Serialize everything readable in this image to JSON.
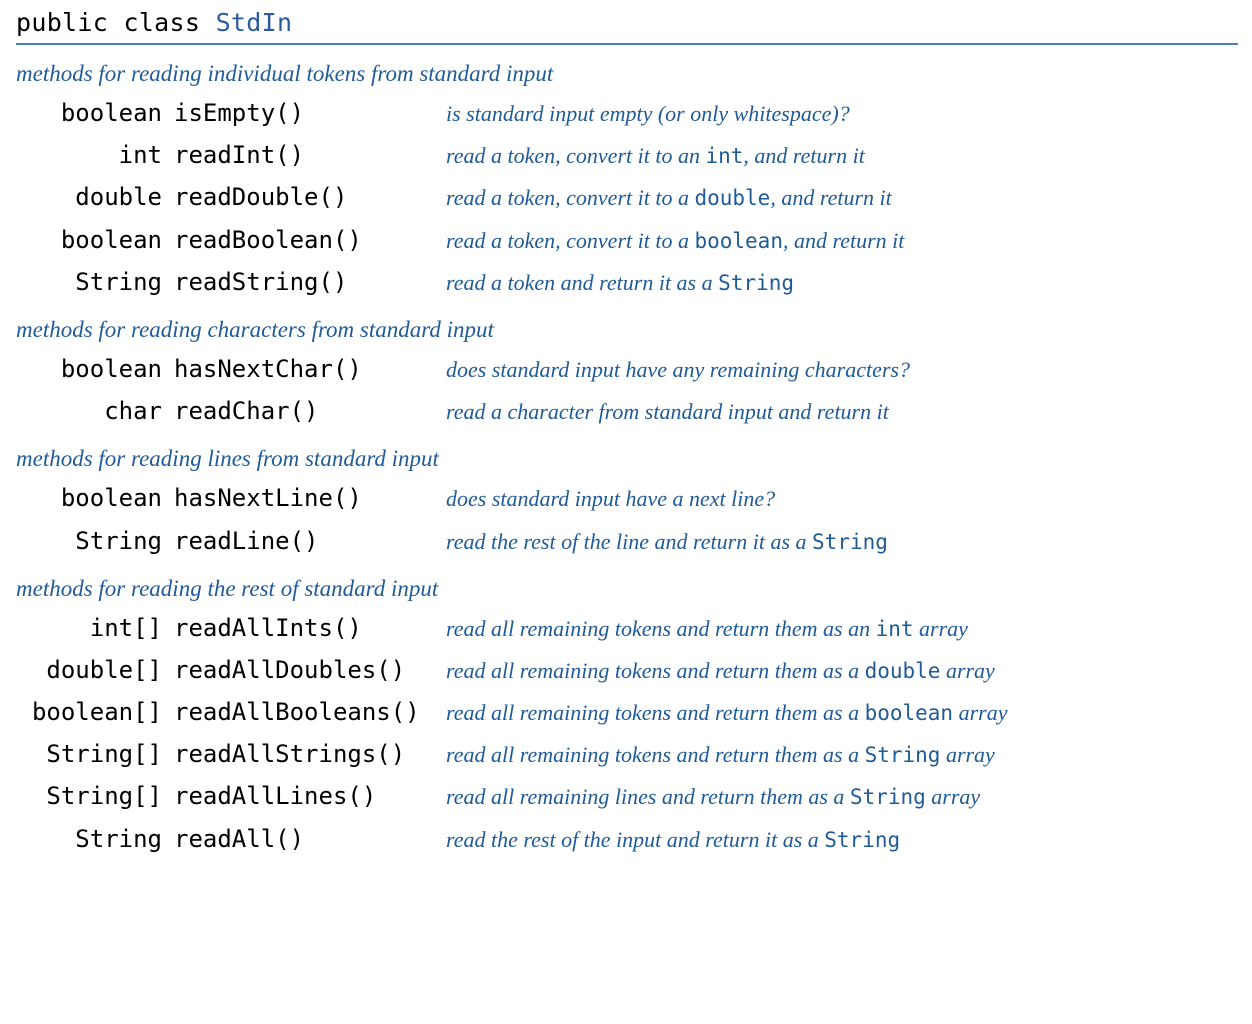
{
  "header": {
    "prefix": "public class",
    "className": "StdIn"
  },
  "sections": [
    {
      "title": "methods for reading individual tokens from standard input",
      "methods": [
        {
          "ret": "boolean",
          "name": "isEmpty()",
          "desc_parts": [
            {
              "t": "is standard input empty (or only whitespace)?"
            }
          ]
        },
        {
          "ret": "int",
          "name": "readInt()",
          "desc_parts": [
            {
              "t": "read a token, convert it to an "
            },
            {
              "t": "int",
              "code": true
            },
            {
              "t": ", and return it"
            }
          ]
        },
        {
          "ret": "double",
          "name": "readDouble()",
          "desc_parts": [
            {
              "t": "read a token, convert it to a "
            },
            {
              "t": "double",
              "code": true
            },
            {
              "t": ", and return it"
            }
          ]
        },
        {
          "ret": "boolean",
          "name": "readBoolean()",
          "desc_parts": [
            {
              "t": "read a token, convert it to a "
            },
            {
              "t": "boolean",
              "code": true
            },
            {
              "t": ", and return it"
            }
          ]
        },
        {
          "ret": "String",
          "name": "readString()",
          "desc_parts": [
            {
              "t": "read a token and return it as a "
            },
            {
              "t": "String",
              "code": true
            }
          ]
        }
      ]
    },
    {
      "title": "methods for reading characters from standard input",
      "methods": [
        {
          "ret": "boolean",
          "name": "hasNextChar()",
          "desc_parts": [
            {
              "t": "does standard input have any remaining characters?"
            }
          ]
        },
        {
          "ret": "char",
          "name": "readChar()",
          "desc_parts": [
            {
              "t": "read a character from standard input and return it"
            }
          ]
        }
      ]
    },
    {
      "title": "methods for reading lines from standard input",
      "methods": [
        {
          "ret": "boolean",
          "name": "hasNextLine()",
          "desc_parts": [
            {
              "t": "does standard input have a next line?"
            }
          ]
        },
        {
          "ret": "String",
          "name": "readLine()",
          "desc_parts": [
            {
              "t": "read the rest of the line and return it as a "
            },
            {
              "t": "String",
              "code": true
            }
          ]
        }
      ]
    },
    {
      "title": "methods for reading the rest of standard input",
      "methods": [
        {
          "ret": "int[]",
          "name": "readAllInts()",
          "desc_parts": [
            {
              "t": "read all remaining tokens and return them as an "
            },
            {
              "t": "int",
              "code": true
            },
            {
              "t": " array"
            }
          ]
        },
        {
          "ret": "double[]",
          "name": "readAllDoubles()",
          "desc_parts": [
            {
              "t": "read all remaining tokens and return them as a "
            },
            {
              "t": "double",
              "code": true
            },
            {
              "t": " array"
            }
          ]
        },
        {
          "ret": "boolean[]",
          "name": "readAllBooleans()",
          "desc_parts": [
            {
              "t": "read all remaining tokens and return them as a "
            },
            {
              "t": "boolean",
              "code": true
            },
            {
              "t": " array"
            }
          ]
        },
        {
          "ret": "String[]",
          "name": "readAllStrings()",
          "desc_parts": [
            {
              "t": "read all remaining tokens and return them as a "
            },
            {
              "t": "String",
              "code": true
            },
            {
              "t": " array"
            }
          ]
        },
        {
          "ret": "String[]",
          "name": "readAllLines()",
          "desc_parts": [
            {
              "t": "read all remaining lines and return them as a "
            },
            {
              "t": "String",
              "code": true
            },
            {
              "t": " array"
            }
          ]
        },
        {
          "ret": "String",
          "name": "readAll()",
          "desc_parts": [
            {
              "t": "read the rest of the input and return it as a "
            },
            {
              "t": "String",
              "code": true
            }
          ]
        }
      ]
    }
  ]
}
